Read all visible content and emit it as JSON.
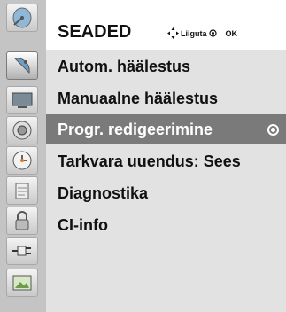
{
  "header": {
    "title": "SEADED",
    "move_hint": "Liiguta",
    "ok_hint": "OK"
  },
  "sidebar": {
    "icons": [
      "satellite-dish-icon",
      "monitor-icon",
      "speaker-icon",
      "clock-icon",
      "calendar-icon",
      "lock-icon",
      "plug-cable-icon",
      "photo-icon"
    ],
    "active_index": 0
  },
  "menu": {
    "items": [
      {
        "label": "Autom. häälestus"
      },
      {
        "label": "Manuaalne häälestus"
      },
      {
        "label": "Progr. redigeerimine"
      },
      {
        "label": "Tarkvara uuendus: Sees"
      },
      {
        "label": "Diagnostika"
      },
      {
        "label": "CI-info"
      }
    ],
    "selected_index": 2
  },
  "colors": {
    "background": "#e2e2e2",
    "sidebar": "#c4c4c4",
    "selection": "#7a7a7a",
    "header": "#ffffff"
  }
}
